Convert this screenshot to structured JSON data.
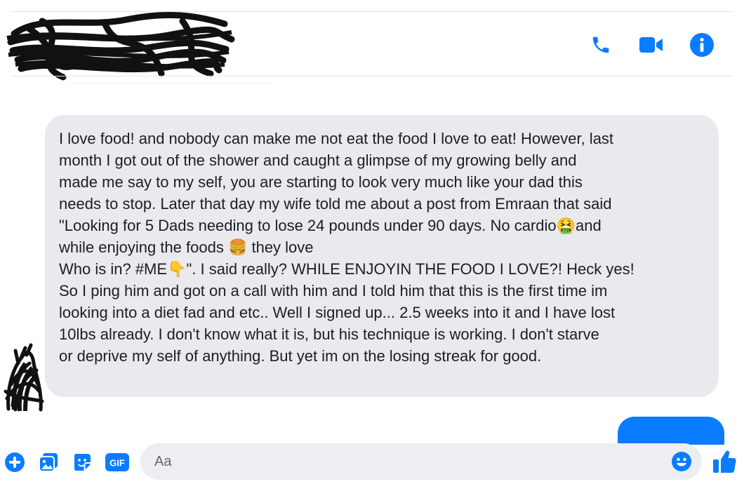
{
  "header": {
    "name_redacted": "",
    "actions": [
      {
        "icon": "phone-icon",
        "color": "#0a7cff"
      },
      {
        "icon": "video-icon",
        "color": "#0a7cff"
      },
      {
        "icon": "info-icon",
        "color": "#0a7cff"
      }
    ]
  },
  "message": {
    "lines": [
      "I love food! and nobody can make me not eat the food I love to eat! However, last",
      "month I got out of the shower and caught a glimpse of my growing belly and",
      "made me say to my self, you are starting to look very much like your dad this",
      "needs to stop. Later that day my wife told me about a post from Emraan that said",
      "\"Looking for 5 Dads needing to lose 24 pounds under 90 days. No cardio",
      "and",
      "while enjoying the foods",
      " they love",
      "Who is in? #ME",
      "\". I said really? WHILE ENJOYIN THE FOOD I LOVE?! Heck yes!",
      "So I ping him and  got on a call with him and I told him that this is the first time im",
      "looking into a diet fad and etc.. Well I signed up... 2.5 weeks into it and I have lost",
      "10lbs already. I don't know what it is, but his technique is working. I don't starve",
      "or deprive my self of anything. But yet im on the losing streak for good."
    ],
    "emoji": {
      "nauseated": "🤮",
      "burger": "🍔",
      "point_down": "👇"
    }
  },
  "composer": {
    "placeholder": "Aa",
    "tools": [
      "add-icon",
      "photo-icon",
      "sticker-icon",
      "gif-icon"
    ],
    "gif_label": "GIF"
  },
  "colors": {
    "accent": "#0a7cff",
    "bubble_bg": "#e9eaed",
    "input_bg": "#eceef1"
  }
}
